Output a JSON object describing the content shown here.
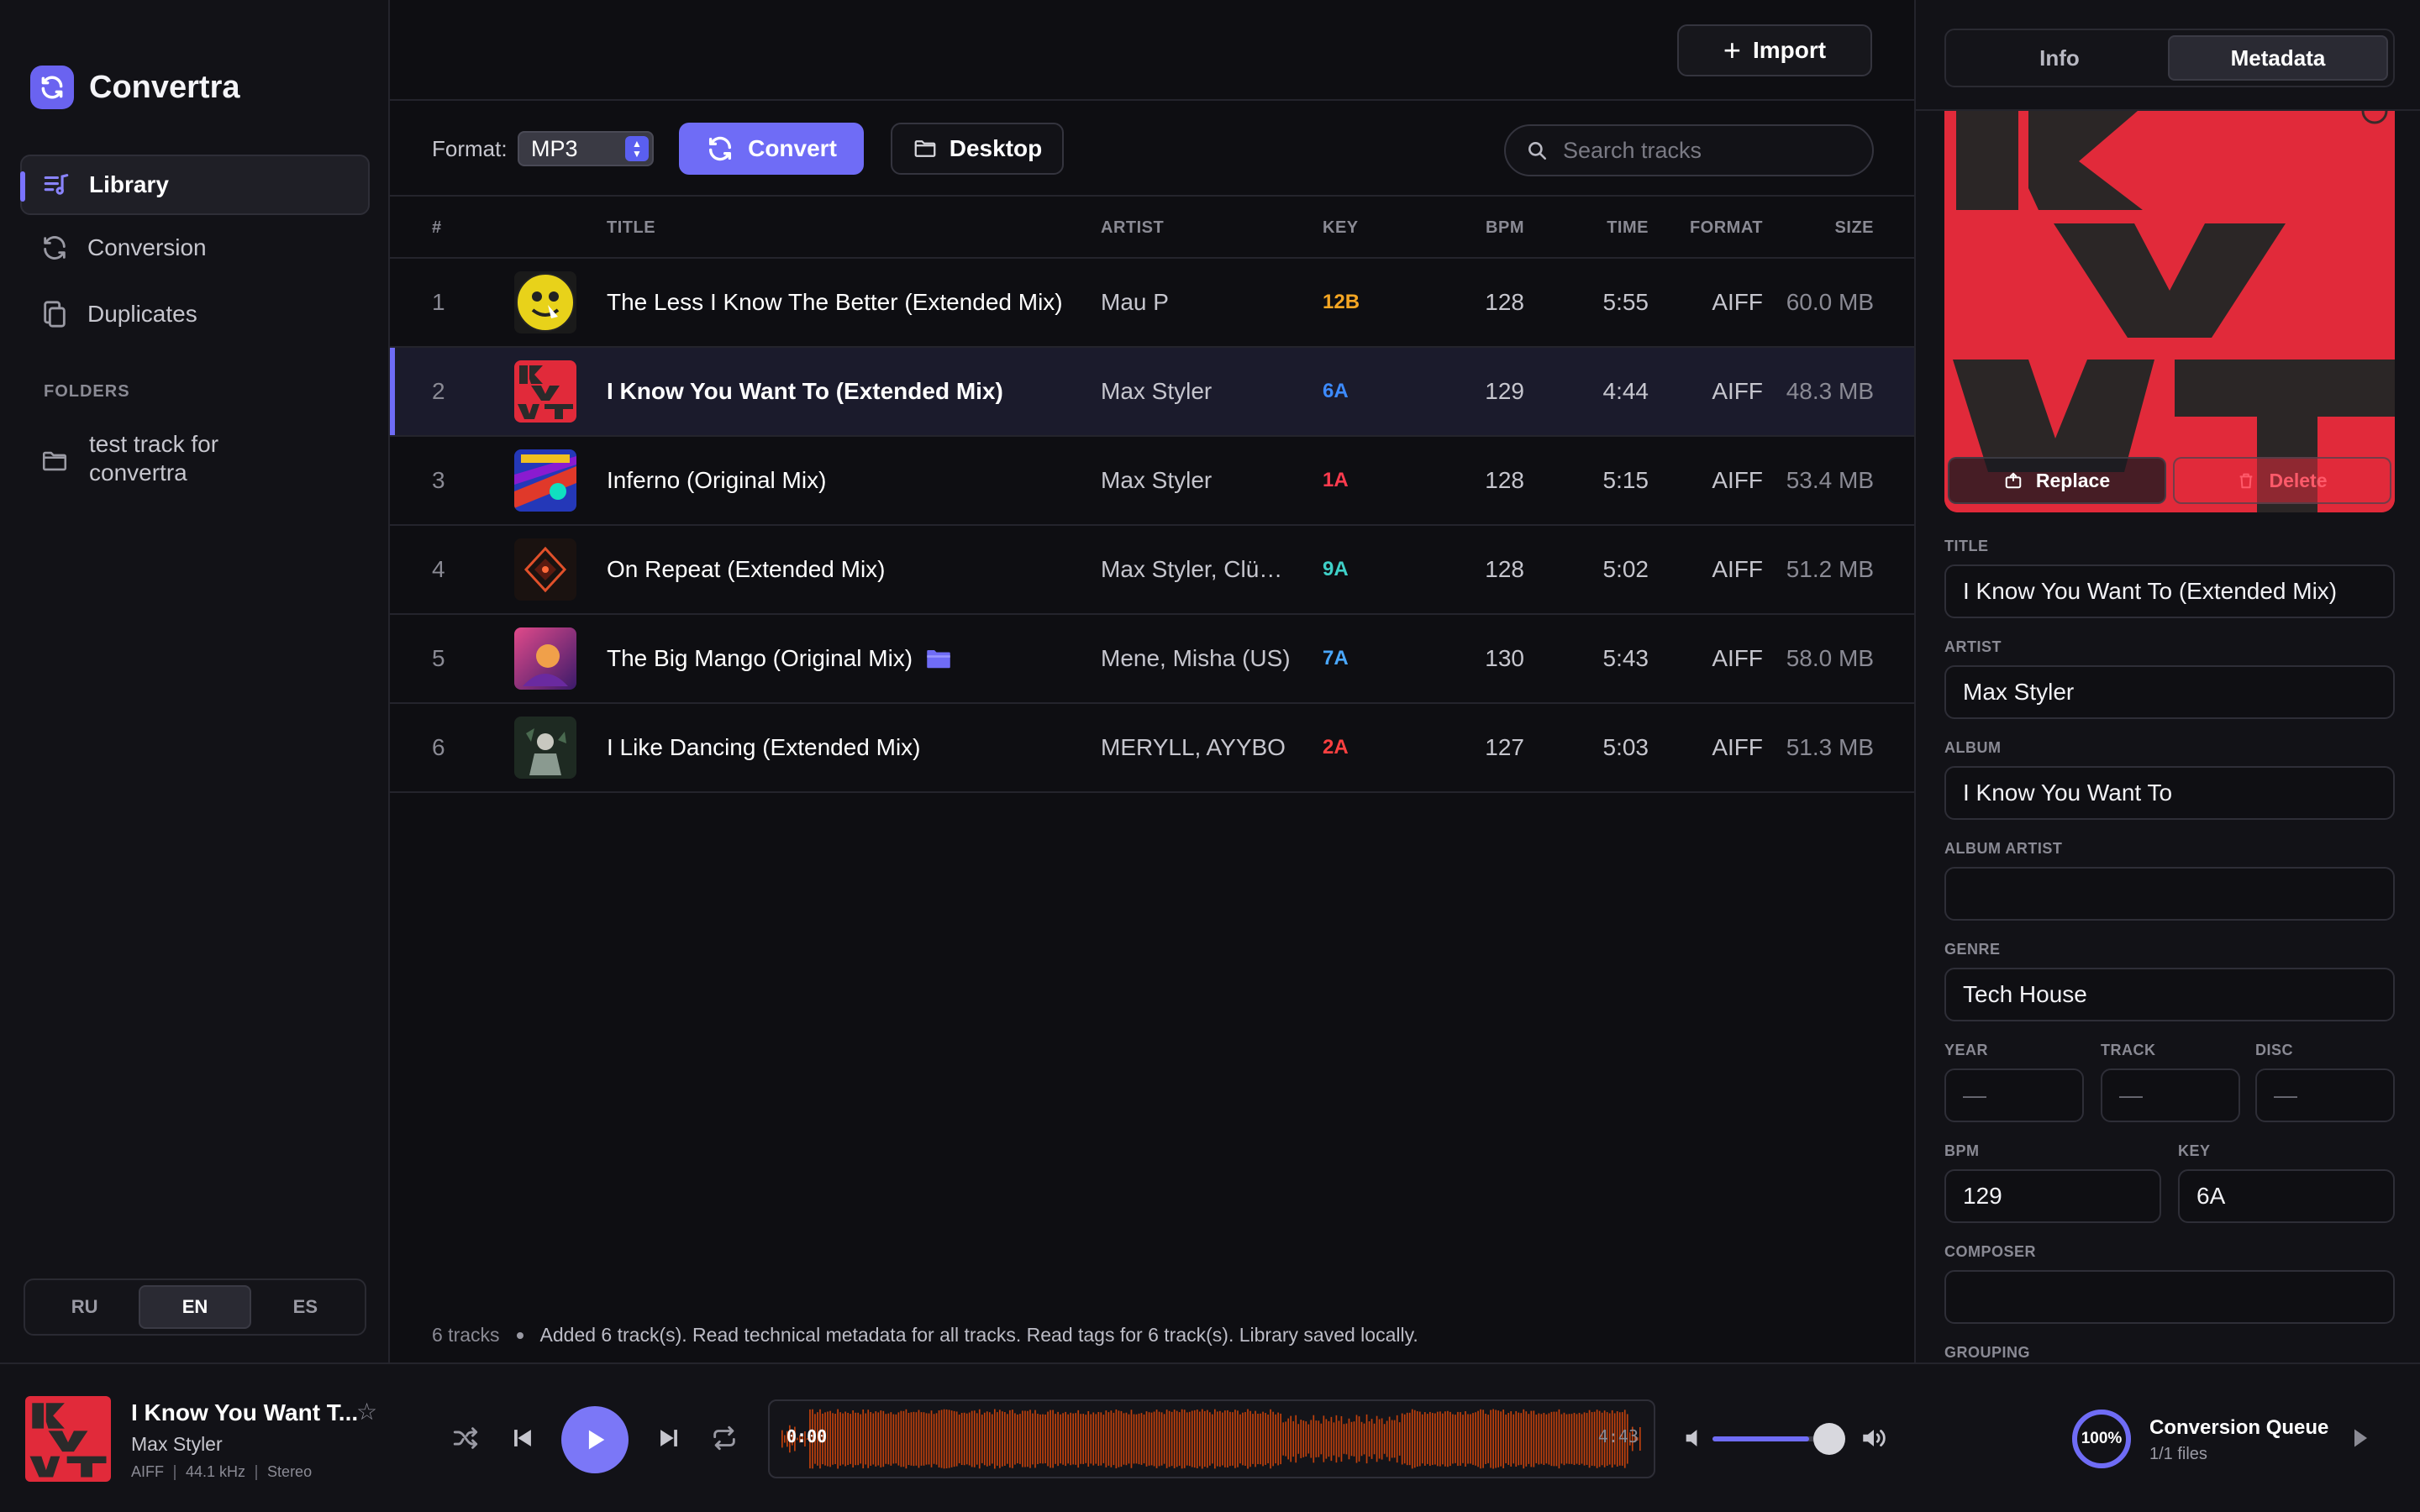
{
  "app": {
    "name": "Convertra"
  },
  "sidebar": {
    "items": [
      {
        "label": "Library",
        "icon": "music-list-icon",
        "active": true
      },
      {
        "label": "Conversion",
        "icon": "sync-icon"
      },
      {
        "label": "Duplicates",
        "icon": "copy-icon"
      }
    ],
    "folders_heading": "FOLDERS",
    "folders": [
      {
        "label": "test track for convertra",
        "icon": "folder-icon"
      }
    ],
    "languages": [
      {
        "label": "RU"
      },
      {
        "label": "EN",
        "active": true
      },
      {
        "label": "ES"
      }
    ]
  },
  "topbar": {
    "import_label": "Import"
  },
  "toolbar": {
    "format_label": "Format:",
    "format_value": "MP3",
    "convert_label": "Convert",
    "destination_label": "Desktop",
    "search_placeholder": "Search tracks"
  },
  "table": {
    "columns": {
      "num": "#",
      "title": "TITLE",
      "artist": "ARTIST",
      "key": "KEY",
      "bpm": "BPM",
      "time": "TIME",
      "format": "FORMAT",
      "size": "SIZE"
    },
    "rows": [
      {
        "num": "1",
        "title": "The Less I Know The Better (Extended Mix)",
        "artist": "Mau P",
        "key": "12B",
        "key_color": "#f5a623",
        "bpm": "128",
        "time": "5:55",
        "format": "AIFF",
        "size": "60.0 MB"
      },
      {
        "num": "2",
        "title": "I Know You Want To (Extended Mix)",
        "artist": "Max Styler",
        "key": "6A",
        "key_color": "#3d8bff",
        "bpm": "129",
        "time": "4:44",
        "format": "AIFF",
        "size": "48.3 MB",
        "selected": true
      },
      {
        "num": "3",
        "title": "Inferno (Original Mix)",
        "artist": "Max Styler",
        "key": "1A",
        "key_color": "#ff3b4e",
        "bpm": "128",
        "time": "5:15",
        "format": "AIFF",
        "size": "53.4 MB"
      },
      {
        "num": "4",
        "title": "On Repeat (Extended Mix)",
        "artist": "Max Styler, Clüb…",
        "key": "9A",
        "key_color": "#3fd0c8",
        "bpm": "128",
        "time": "5:02",
        "format": "AIFF",
        "size": "51.2 MB"
      },
      {
        "num": "5",
        "title": "The Big Mango (Original Mix)",
        "artist": "Mene, Misha (US)",
        "key": "7A",
        "key_color": "#4aa8ff",
        "bpm": "130",
        "time": "5:43",
        "format": "AIFF",
        "size": "58.0 MB",
        "folder_icon": true
      },
      {
        "num": "6",
        "title": "I Like Dancing (Extended Mix)",
        "artist": "MERYLL, AYYBO",
        "key": "2A",
        "key_color": "#ff4040",
        "bpm": "127",
        "time": "5:03",
        "format": "AIFF",
        "size": "51.3 MB"
      }
    ]
  },
  "status": {
    "count": "6 tracks",
    "message": "Added 6 track(s). Read technical metadata for all tracks. Read tags for 6 track(s). Library saved locally."
  },
  "panel": {
    "tabs": [
      {
        "label": "Info"
      },
      {
        "label": "Metadata",
        "active": true
      }
    ],
    "art_replace": "Replace",
    "art_delete": "Delete",
    "fields": {
      "title": {
        "label": "TITLE",
        "value": "I Know You Want To (Extended Mix)"
      },
      "artist": {
        "label": "ARTIST",
        "value": "Max Styler"
      },
      "album": {
        "label": "ALBUM",
        "value": "I Know You Want To"
      },
      "album_artist": {
        "label": "ALBUM ARTIST",
        "value": ""
      },
      "genre": {
        "label": "GENRE",
        "value": "Tech House"
      },
      "year": {
        "label": "YEAR",
        "value": "—"
      },
      "track": {
        "label": "TRACK",
        "value": "—"
      },
      "disc": {
        "label": "DISC",
        "value": "—"
      },
      "bpm": {
        "label": "BPM",
        "value": "129"
      },
      "key": {
        "label": "KEY",
        "value": "6A"
      },
      "composer": {
        "label": "COMPOSER",
        "value": ""
      },
      "grouping": {
        "label": "GROUPING"
      }
    }
  },
  "player": {
    "title": "I Know You Want T...",
    "artist": "Max Styler",
    "format": "AIFF",
    "sample_rate": "44.1 kHz",
    "channels": "Stereo",
    "position": "0:00",
    "duration": "4:43",
    "volume": 0.82,
    "accent": "#6f6cf6",
    "wave_color": "#c2410c"
  },
  "queue": {
    "percent": "100%",
    "progress": 1.0,
    "title": "Conversion Queue",
    "subtitle": "1/1 files"
  }
}
